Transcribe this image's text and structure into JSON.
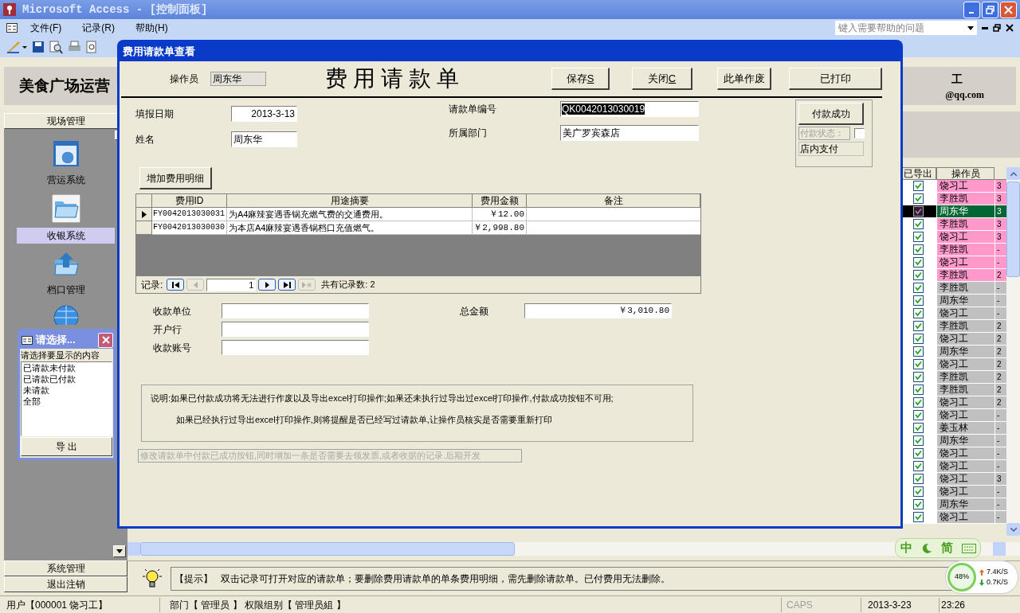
{
  "window": {
    "title": "Microsoft Access - [控制面板]"
  },
  "menu": [
    "文件(F)",
    "记录(R)",
    "帮助(H)"
  ],
  "help_field": {
    "placeholder": "键入需要帮助的问题"
  },
  "header": {
    "title": "美食广场运营",
    "user_tail": "工",
    "email": "@qq.com"
  },
  "sidebar": {
    "group": "现场管理",
    "items": [
      {
        "label": "营运系统",
        "kind": "browser",
        "selected": false
      },
      {
        "label": "收银系统",
        "kind": "folder",
        "selected": true
      },
      {
        "label": "档口管理",
        "kind": "folder-up",
        "selected": false
      },
      {
        "kind": "globe"
      }
    ],
    "bottom": [
      "系统管理",
      "退出注销"
    ]
  },
  "table": {
    "columns": [
      "已导出",
      "操作员"
    ],
    "rows": [
      {
        "exported": true,
        "operator": "饶习工",
        "column_3": "3",
        "color": "#ff99cc",
        "selected": false
      },
      {
        "exported": true,
        "operator": "李胜凯",
        "column_3": "3",
        "color": "#ff99cc",
        "selected": false
      },
      {
        "exported": true,
        "operator": "周东华",
        "column_3": "3",
        "selected": true
      },
      {
        "exported": true,
        "operator": "李胜凯",
        "column_3": "3",
        "color": "#ff99cc",
        "selected": false
      },
      {
        "exported": true,
        "operator": "饶习工",
        "column_3": "3",
        "color": "#ff99cc",
        "selected": false
      },
      {
        "exported": true,
        "operator": "李胜凯",
        "column_3": "-",
        "color": "#ff99cc",
        "selected": false
      },
      {
        "exported": true,
        "operator": "饶习工",
        "column_3": "-",
        "color": "#ff99cc",
        "selected": false
      },
      {
        "exported": true,
        "operator": "李胜凯",
        "column_3": "2",
        "color": "#ff99cc",
        "selected": false
      },
      {
        "exported": true,
        "operator": "李胜凯",
        "column_3": "-",
        "color": "#c0c0c0",
        "selected": false
      },
      {
        "exported": true,
        "operator": "周东华",
        "column_3": "-",
        "color": "#c0c0c0",
        "selected": false
      },
      {
        "exported": true,
        "operator": "饶习工",
        "column_3": "-",
        "color": "#c0c0c0",
        "selected": false
      },
      {
        "exported": true,
        "operator": "李胜凯",
        "column_3": "2",
        "color": "#c0c0c0",
        "selected": false
      },
      {
        "exported": true,
        "operator": "饶习工",
        "column_3": "2",
        "color": "#c0c0c0",
        "selected": false
      },
      {
        "exported": true,
        "operator": "周东华",
        "column_3": "2",
        "color": "#c0c0c0",
        "selected": false
      },
      {
        "exported": true,
        "operator": "饶习工",
        "column_3": "2",
        "color": "#c0c0c0",
        "selected": false
      },
      {
        "exported": true,
        "operator": "李胜凯",
        "column_3": "2",
        "color": "#c0c0c0",
        "selected": false
      },
      {
        "exported": true,
        "operator": "李胜凯",
        "column_3": "2",
        "color": "#c0c0c0",
        "selected": false
      },
      {
        "exported": true,
        "operator": "饶习工",
        "column_3": "2",
        "color": "#c0c0c0",
        "selected": false
      },
      {
        "exported": true,
        "operator": "饶习工",
        "column_3": "-",
        "color": "#c0c0c0",
        "selected": false
      },
      {
        "exported": true,
        "operator": "姜玉林",
        "column_3": "-",
        "color": "#c0c0c0",
        "selected": false
      },
      {
        "exported": true,
        "operator": "周东华",
        "column_3": "-",
        "color": "#c0c0c0",
        "selected": false
      },
      {
        "exported": true,
        "operator": "饶习工",
        "column_3": "-",
        "color": "#c0c0c0",
        "selected": false
      },
      {
        "exported": true,
        "operator": "饶习工",
        "column_3": "-",
        "color": "#c0c0c0",
        "selected": false
      },
      {
        "exported": true,
        "operator": "饶习工",
        "column_3": "3",
        "color": "#c0c0c0",
        "selected": false
      },
      {
        "exported": true,
        "operator": "饶习工",
        "column_3": "-",
        "color": "#c0c0c0",
        "selected": false
      },
      {
        "exported": true,
        "operator": "周东华",
        "column_3": "-",
        "color": "#c0c0c0",
        "selected": false
      },
      {
        "exported": true,
        "operator": "饶习工",
        "column_3": "-",
        "color": "#c0c0c0",
        "selected": false
      }
    ]
  },
  "hint": {
    "label": "【提示】",
    "text": "双击记录可打开对应的请款单；要删除费用请款单的单条费用明细，需先删除请款单。已付费用无法删除。"
  },
  "status_bar": {
    "user": "用户【000001 饶习工】",
    "dept": "部门【 管理员 】 权限组别【 管理员組 】",
    "caps": "CAPS",
    "date": "2013-3-23",
    "time": "23:26"
  },
  "ime": [
    "中",
    "简"
  ],
  "net": {
    "percent": "48%",
    "up": "7.4K/S",
    "down": "0.7K/S"
  },
  "chooser": {
    "title": "请选择...",
    "prompt": "请选择要显示的内容",
    "options": [
      {
        "label": "已请款未付款",
        "selected": false
      },
      {
        "label": "已请款已付款",
        "selected": false
      },
      {
        "label": "未请款",
        "selected": false
      },
      {
        "label": "全部",
        "selected": false
      }
    ],
    "button": "导 出"
  },
  "dialog": {
    "title": "费用请款单查看",
    "operator_label": "操作员",
    "operator": "周东华",
    "heading": "费 用 请 款 单",
    "buttons": [
      {
        "label": "保存",
        "accel": "S"
      },
      {
        "label": "关闭",
        "accel": "C"
      },
      {
        "label": "此单作废"
      },
      {
        "label": "已打印"
      }
    ],
    "date": {
      "label": "填报日期",
      "value": "2013-3-13"
    },
    "name": {
      "label": "姓名",
      "value": "周东华"
    },
    "number": {
      "label": "请款单编号",
      "value": "QK0042013030019",
      "selected": true
    },
    "dept": {
      "label": "所属部门",
      "value": "美广罗宾森店"
    },
    "payment": {
      "button": "付款成功",
      "status_label": "付款状态：",
      "paid": false,
      "method": "店内支付"
    },
    "add_button": "增加费用明细",
    "details": {
      "columns": [
        "费用ID",
        "用途摘要",
        "费用金额",
        "备注"
      ],
      "rows": [
        {
          "id": "FY0042013030031",
          "summary": "为A4麻辣宴遇香锅充燃气费的交通费用。",
          "amount": "￥12.00",
          "selected": true
        },
        {
          "id": "FY0042013030030",
          "summary": "为本店A4麻辣宴遇香锅档口充值燃气。",
          "amount": "￥2,998.80",
          "selected": false
        }
      ],
      "nav": {
        "label": "记录:",
        "current": "1",
        "total": "共有记录数: 2"
      }
    },
    "payee_fields": [
      "收款单位",
      "开户行",
      "收款账号"
    ],
    "total": {
      "label": "总金额",
      "value": "￥3,010.80"
    },
    "note": [
      "说明:如果已付款成功将无法进行作废以及导出excel打印操作;如果还未执行过导出过excel打印操作,付款成功按钮不可用;",
      "如果已经执行过导出excel打印操作,则将提醒是否已经写过请款单,让操作员核实是否需要重新打印"
    ],
    "dev_button": {
      "label": "修改请款单中付款已成功按钮,同时增加一条是否需要去领发票,或者收据的记录.后期开发",
      "disabled": true
    }
  }
}
